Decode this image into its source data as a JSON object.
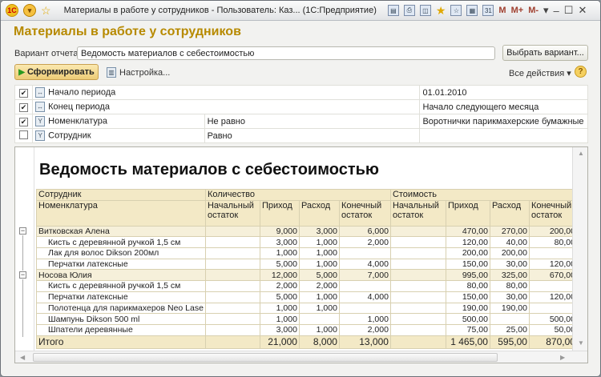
{
  "window": {
    "title": "Материалы в работе у сотрудников - Пользователь: Каз... (1С:Предприятие)",
    "logo": "1С",
    "m_buttons": [
      "M",
      "M+",
      "M-"
    ]
  },
  "form": {
    "title": "Материалы в работе у сотрудников",
    "variant_label": "Вариант отчета:",
    "variant_value": "Ведомость материалов с себестоимостью",
    "choose_variant": "Выбрать вариант...",
    "generate": "Сформировать",
    "settings": "Настройка...",
    "all_actions": "Все действия",
    "help": "?"
  },
  "filters": [
    {
      "checked": true,
      "name": "Начало периода",
      "cond": "",
      "value": "01.01.2010"
    },
    {
      "checked": true,
      "name": "Конец периода",
      "cond": "",
      "value": "Начало следующего месяца"
    },
    {
      "checked": true,
      "name": "Номенклатура",
      "cond": "Не равно",
      "value": "Воротнички парикмахерские бумажные"
    },
    {
      "checked": false,
      "name": "Сотрудник",
      "cond": "Равно",
      "value": ""
    }
  ],
  "report": {
    "title": "Ведомость материалов с себестоимостью",
    "headers": {
      "employee": "Сотрудник",
      "item": "Номенклатура",
      "qty": "Количество",
      "cost": "Стоимость",
      "opening": "Начальный остаток",
      "in": "Приход",
      "out": "Расход",
      "closing": "Конечный остаток"
    },
    "rows": [
      {
        "group": true,
        "name": "Витковская Алена",
        "v": [
          "",
          "9,000",
          "3,000",
          "6,000",
          "",
          "470,00",
          "270,00",
          "200,00"
        ]
      },
      {
        "group": false,
        "name": "Кисть с деревянной ручкой 1,5 см",
        "v": [
          "",
          "3,000",
          "1,000",
          "2,000",
          "",
          "120,00",
          "40,00",
          "80,00"
        ]
      },
      {
        "group": false,
        "name": "Лак для волос Dikson 200мл",
        "v": [
          "",
          "1,000",
          "1,000",
          "",
          "",
          "200,00",
          "200,00",
          ""
        ]
      },
      {
        "group": false,
        "name": "Перчатки латексные",
        "v": [
          "",
          "5,000",
          "1,000",
          "4,000",
          "",
          "150,00",
          "30,00",
          "120,00"
        ]
      },
      {
        "group": true,
        "name": "Носова Юлия",
        "v": [
          "",
          "12,000",
          "5,000",
          "7,000",
          "",
          "995,00",
          "325,00",
          "670,00"
        ]
      },
      {
        "group": false,
        "name": "Кисть с деревянной ручкой 1,5 см",
        "v": [
          "",
          "2,000",
          "2,000",
          "",
          "",
          "80,00",
          "80,00",
          ""
        ]
      },
      {
        "group": false,
        "name": "Перчатки латексные",
        "v": [
          "",
          "5,000",
          "1,000",
          "4,000",
          "",
          "150,00",
          "30,00",
          "120,00"
        ]
      },
      {
        "group": false,
        "name": "Полотенца для парикмахеров Neo Lase",
        "v": [
          "",
          "1,000",
          "1,000",
          "",
          "",
          "190,00",
          "190,00",
          ""
        ]
      },
      {
        "group": false,
        "name": "Шампунь Dikson 500 ml",
        "v": [
          "",
          "1,000",
          "",
          "1,000",
          "",
          "500,00",
          "",
          "500,00"
        ]
      },
      {
        "group": false,
        "name": "Шпатели деревянные",
        "v": [
          "",
          "3,000",
          "1,000",
          "2,000",
          "",
          "75,00",
          "25,00",
          "50,00"
        ]
      }
    ],
    "total": {
      "name": "Итого",
      "v": [
        "",
        "21,000",
        "8,000",
        "13,000",
        "",
        "1 465,00",
        "595,00",
        "870,00"
      ]
    }
  }
}
